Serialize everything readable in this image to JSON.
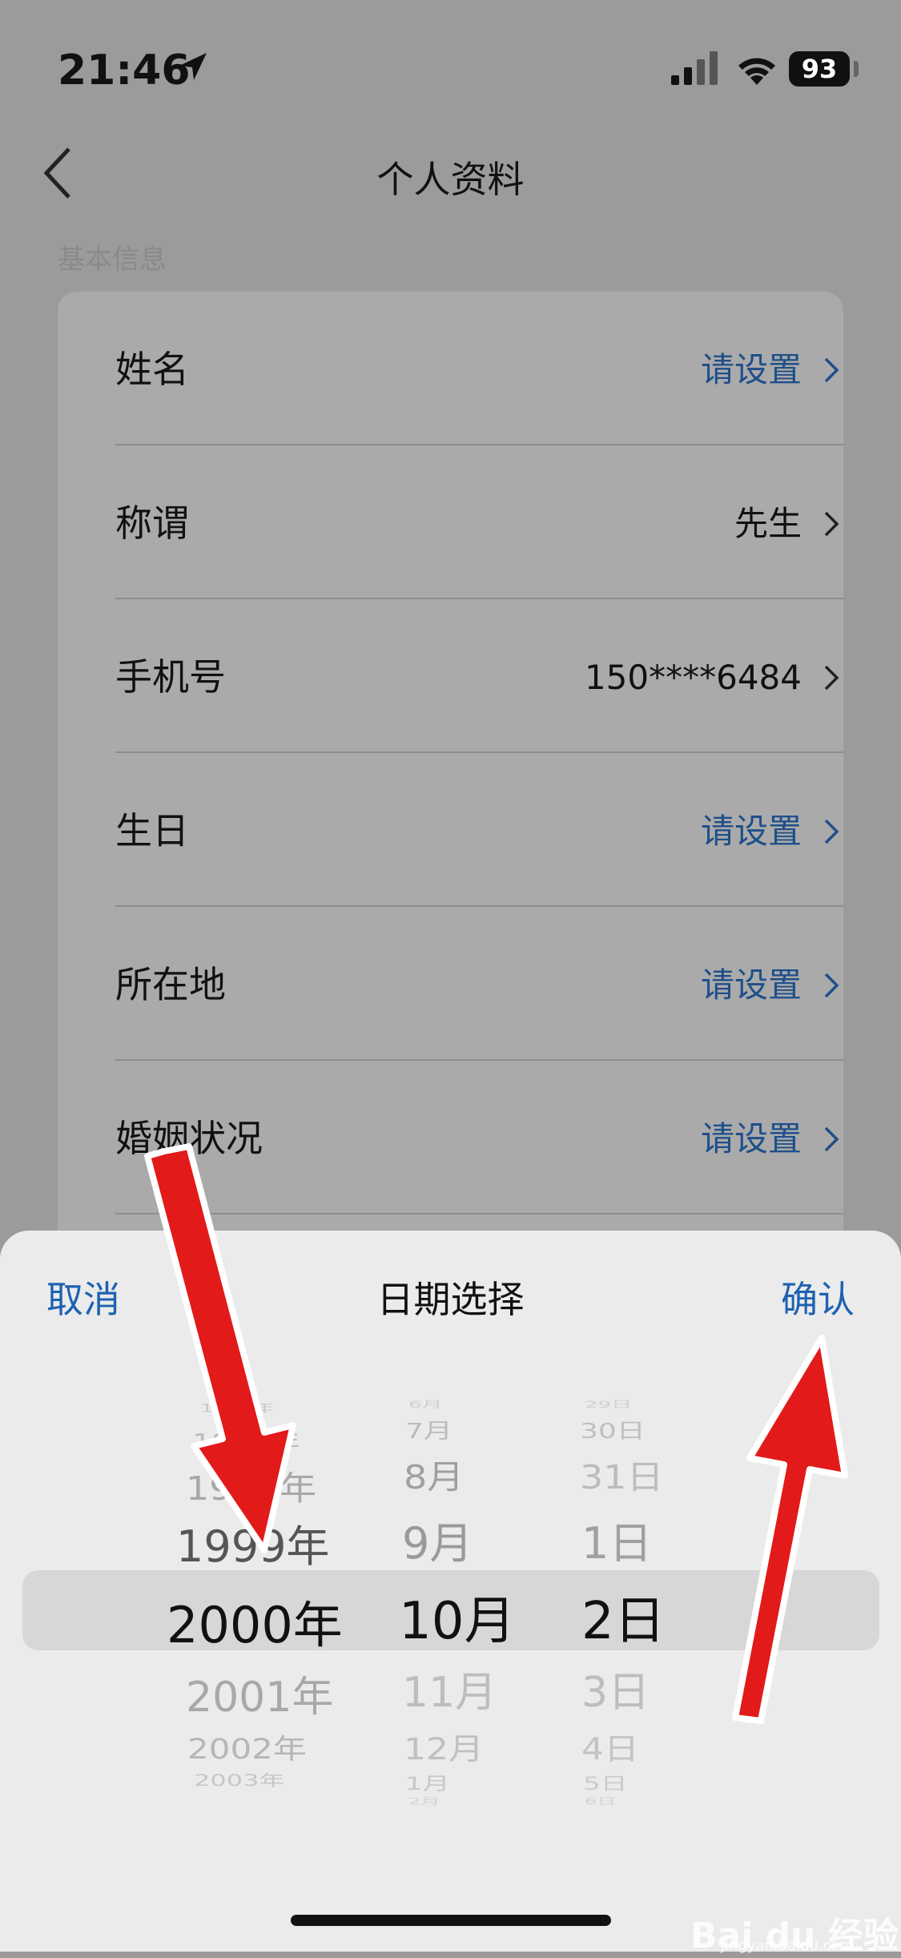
{
  "status_bar": {
    "time": "21:46",
    "battery": "93"
  },
  "nav": {
    "title": "个人资料"
  },
  "section_label": "基本信息",
  "rows": [
    {
      "label": "姓名",
      "value": "请设置",
      "is_link": true
    },
    {
      "label": "称谓",
      "value": "先生",
      "is_link": false
    },
    {
      "label": "手机号",
      "value": "150****6484",
      "is_link": false
    },
    {
      "label": "生日",
      "value": "请设置",
      "is_link": true
    },
    {
      "label": "所在地",
      "value": "请设置",
      "is_link": true
    },
    {
      "label": "婚姻状况",
      "value": "请设置",
      "is_link": true
    }
  ],
  "sheet": {
    "cancel": "取消",
    "title": "日期选择",
    "confirm": "确认",
    "years": [
      "1996年",
      "1997年",
      "1998年",
      "1999年",
      "2000年",
      "2001年",
      "2002年",
      "2003年"
    ],
    "months": [
      "6月",
      "7月",
      "8月",
      "9月",
      "10月",
      "11月",
      "12月",
      "1月",
      "2月"
    ],
    "days": [
      "29日",
      "30日",
      "31日",
      "1日",
      "2日",
      "3日",
      "4日",
      "5日",
      "6日"
    ]
  },
  "watermark": {
    "text": "Bai du 经验",
    "sub": "jingyan.baidu.com"
  },
  "colors": {
    "link": "#1d62b2",
    "arrow": "#e21a1a",
    "overlay": "#9b9b9b"
  }
}
